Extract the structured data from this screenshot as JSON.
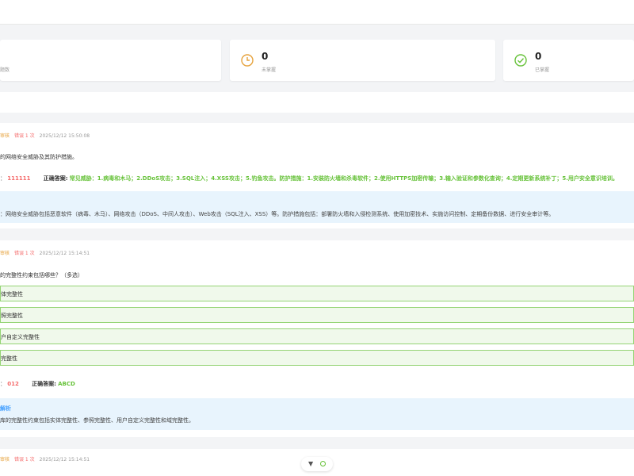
{
  "stats": [
    {
      "value": "",
      "label": "题数"
    },
    {
      "value": "0",
      "label": "未掌握",
      "icon": "clock-icon",
      "color": "#e6a23c"
    },
    {
      "value": "0",
      "label": "已掌握",
      "icon": "check-circle-icon",
      "color": "#67c23a"
    }
  ],
  "questions": [
    {
      "tag": "审核",
      "errors": "错误 1 次",
      "time": "2025/12/12 15:50:08",
      "text": "的网络安全威胁及其防护措施。",
      "my_label": "：",
      "my_answer": "111111",
      "correct_label": "正确答案:",
      "correct_answer": "常见威胁：1.病毒和木马；2.DDoS攻击；3.SQL注入；4.XSS攻击；5.钓鱼攻击。防护措施：1.安装防火墙和杀毒软件；2.使用HTTPS加密传输；3.输入验证和参数化查询；4.定期更新系统补丁；5.用户安全意识培训。",
      "analysis_title": "",
      "analysis": "：网络安全威胁包括恶意软件（病毒、木马）、网络攻击（DDoS、中间人攻击）、Web攻击（SQL注入、XSS）等。防护措施包括：部署防火墙和入侵检测系统、使用加密技术、实施访问控制、定期备份数据、进行安全审计等。"
    },
    {
      "tag": "审核",
      "errors": "错误 1 次",
      "time": "2025/12/12 15:14:51",
      "text": "的完整性约束包括哪些？（多选）",
      "options": [
        "体完整性",
        "照完整性",
        "户自定义完整性",
        "完整性"
      ],
      "my_label": "：",
      "my_answer": "012",
      "correct_label": "正确答案:",
      "correct_answer": "ABCD",
      "analysis_title": "解析",
      "analysis": "库的完整性约束包括实体完整性、参照完整性、用户自定义完整性和域完整性。"
    },
    {
      "tag": "审核",
      "errors": "错误 1 次",
      "time": "2025/12/12 15:14:51"
    }
  ],
  "float": {
    "toggle": "▼"
  }
}
